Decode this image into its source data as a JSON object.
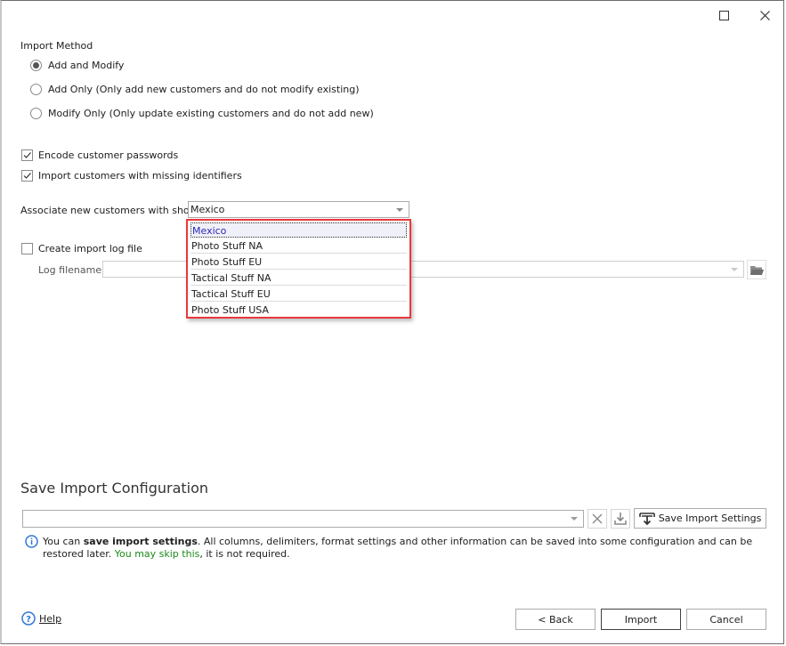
{
  "title_bar": {
    "maximize_icon": "maximize-icon",
    "close_icon": "close-icon"
  },
  "import_method": {
    "label": "Import Method",
    "options": [
      {
        "label": "Add and Modify",
        "checked": true
      },
      {
        "label": "Add Only (Only add new customers and do not modify existing)",
        "checked": false
      },
      {
        "label": "Modify Only (Only update existing customers and do not add new)",
        "checked": false
      }
    ]
  },
  "checkboxes": [
    {
      "label": "Encode customer passwords",
      "checked": true
    },
    {
      "label": "Import customers with missing identifiers",
      "checked": true
    }
  ],
  "shop": {
    "label": "Associate new customers with shop",
    "value": "Mexico",
    "options": [
      "Mexico",
      "Photo Stuff NA",
      "Photo Stuff EU",
      "Tactical Stuff NA",
      "Tactical Stuff EU",
      "Photo Stuff USA"
    ],
    "selected_index": 0,
    "highlight_color": "#e8383d"
  },
  "log": {
    "create_label": "Create import log file",
    "create_checked": false,
    "filename_label": "Log filename",
    "filename_value": "",
    "browse_icon": "folder-icon"
  },
  "save_config": {
    "heading": "Save Import Configuration",
    "config_value": "",
    "clear_icon": "clear-icon",
    "load_icon": "download-icon",
    "save_button": "Save Import Settings",
    "info": {
      "prefix": "You can ",
      "bold": "save import settings",
      "middle": ". All columns, delimiters, format settings and other information can be saved into some configuration and can be restored later. ",
      "green1": "You may skip this",
      "suffix": ", it is not required.",
      "green_color": "#1a8a1a"
    }
  },
  "footer": {
    "help": "Help",
    "back": "< Back",
    "import": "Import",
    "cancel": "Cancel"
  }
}
